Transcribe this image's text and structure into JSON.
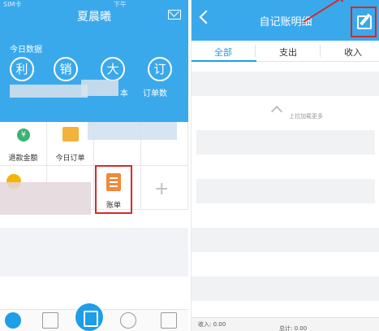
{
  "left_screen": {
    "status_text": "SIM卡",
    "time_text": "下午",
    "title": "夏晨曦",
    "today_label": "今日数据",
    "circle_icons": [
      "利",
      "销",
      "大",
      "订"
    ],
    "stat_labels": [
      "本",
      "订单数"
    ],
    "grid": {
      "refund_label": "退款金额",
      "today_order_label": "今日订单",
      "zhangdan_label": "账单"
    },
    "plus_glyph": "+"
  },
  "right_screen": {
    "title": "自记账明细",
    "tabs": [
      "全部",
      "支出",
      "收入"
    ],
    "pull_text": "上拉加载更多",
    "footer_income": "收入: 0.00",
    "footer_total": "总计: 0.00"
  },
  "colors": {
    "header_blue": "#3aa9ec",
    "accent_blue": "#1e9de8",
    "highlight_red": "#d42a2a"
  }
}
